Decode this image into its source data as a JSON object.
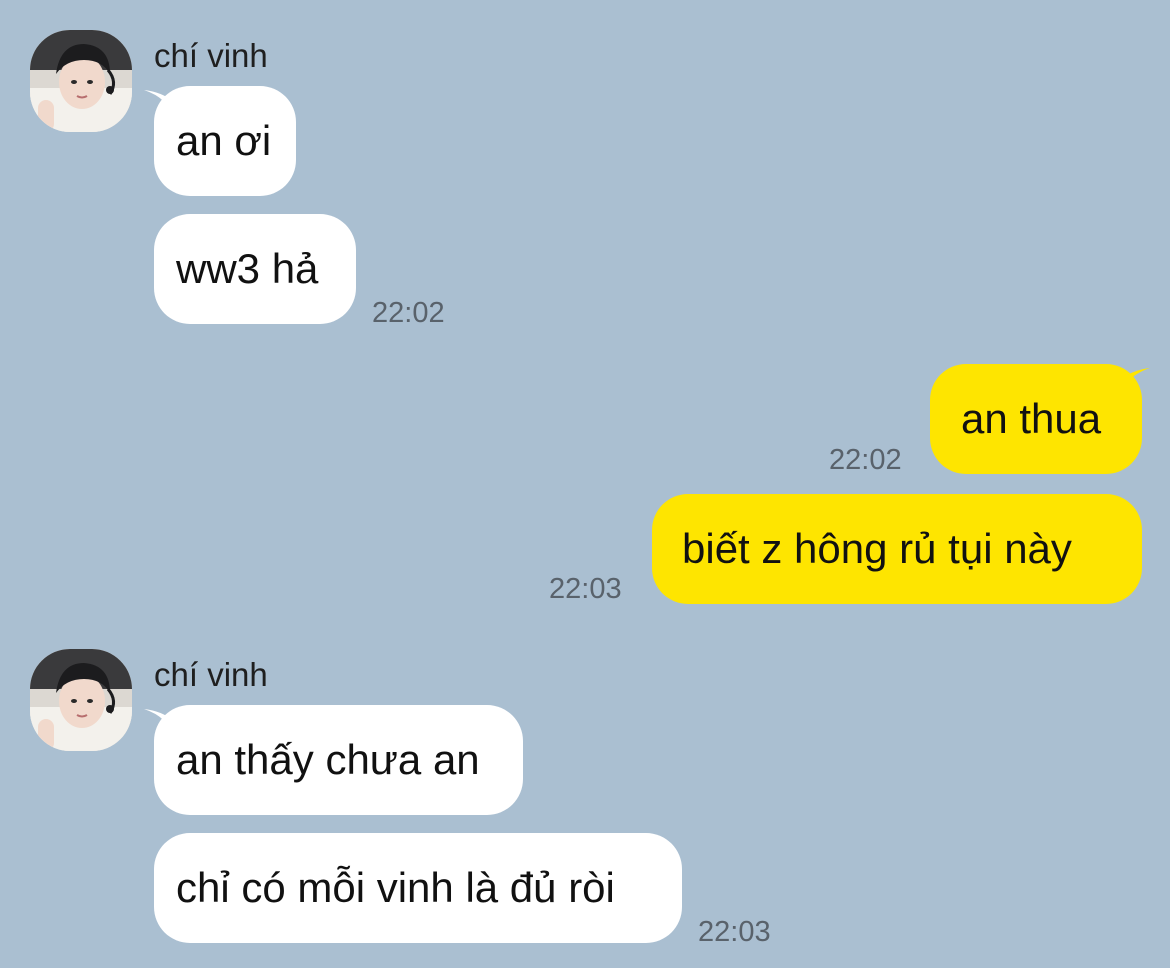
{
  "colors": {
    "background": "#aabfd1",
    "incoming_bubble": "#ffffff",
    "outgoing_bubble": "#fee500",
    "timestamp": "#59626b"
  },
  "groups": [
    {
      "direction": "incoming",
      "sender": "chí vinh",
      "avatar": "profile-photo",
      "messages": [
        {
          "text": "an ơi"
        },
        {
          "text": "ww3 hả",
          "time": "22:02"
        }
      ]
    },
    {
      "direction": "outgoing",
      "messages": [
        {
          "text": "an thua",
          "time": "22:02"
        },
        {
          "text": "biết z hông rủ tụi này",
          "time": "22:03"
        }
      ]
    },
    {
      "direction": "incoming",
      "sender": "chí vinh",
      "avatar": "profile-photo",
      "messages": [
        {
          "text": "an thấy chưa an"
        },
        {
          "text": "chỉ có mỗi vinh là đủ ròi",
          "time": "22:03"
        }
      ]
    }
  ]
}
